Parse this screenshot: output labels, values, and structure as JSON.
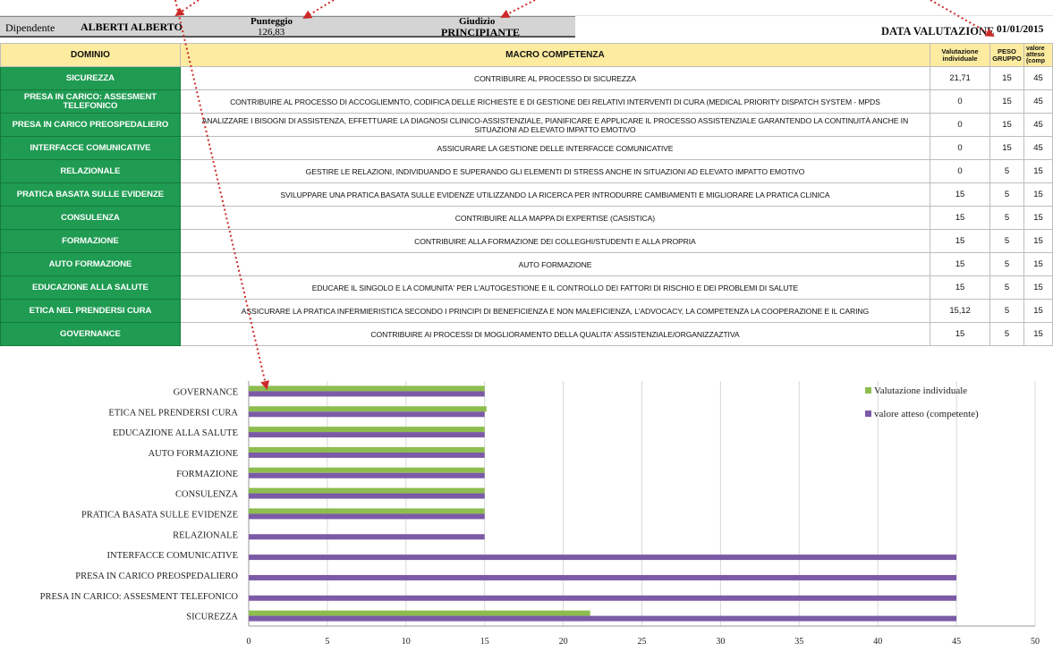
{
  "header": {
    "dipendente_label": "Dipendente",
    "dipendente_value": "ALBERTI ALBERTO",
    "punteggio_label": "Punteggio",
    "punteggio_value": "126,83",
    "giudizio_label": "Giudizio",
    "giudizio_value": "PRINCIPIANTE",
    "data_label": "DATA VALUTAZIONE",
    "data_value": "01/01/2015"
  },
  "table": {
    "headers": {
      "dominio": "DOMINIO",
      "macro": "MACRO COMPETENZA",
      "valutazione": [
        "Valutazione",
        "individuale"
      ],
      "peso": [
        "PESO",
        "GRUPPO"
      ],
      "valore": [
        "valore",
        "atteso",
        "(comp"
      ]
    },
    "rows": [
      {
        "dominio": "SICUREZZA",
        "macro": "CONTRIBUIRE AL PROCESSO DI SICUREZZA",
        "valutazione": "21,71",
        "peso": "15",
        "valore": "45"
      },
      {
        "dominio": "PRESA IN CARICO: ASSESMENT TELEFONICO",
        "macro": "CONTRIBUIRE AL PROCESSO DI ACCOGLIEMNTO, CODIFICA DELLE RICHIESTE E DI GESTIONE DEI RELATIVI INTERVENTI DI CURA (MEDICAL PRIORITY DISPATCH SYSTEM - MPDS",
        "valutazione": "0",
        "peso": "15",
        "valore": "45"
      },
      {
        "dominio": "PRESA IN CARICO  PREOSPEDALIERO",
        "macro": "ANALIZZARE I BISOGNI DI ASSISTENZA, EFFETTUARE LA DIAGNOSI CLINICO-ASSISTENZIALE, PIANIFICARE E APPLICARE IL PROCESSO ASSISTENZIALE  GARANTENDO LA CONTINUITÀ ANCHE IN SITUAZIONI AD ELEVATO IMPATTO EMOTIVO",
        "valutazione": "0",
        "peso": "15",
        "valore": "45"
      },
      {
        "dominio": "INTERFACCE COMUNICATIVE",
        "macro": "ASSICURARE LA GESTIONE DELLE INTERFACCE COMUNICATIVE",
        "valutazione": "0",
        "peso": "15",
        "valore": "45"
      },
      {
        "dominio": "RELAZIONALE",
        "macro": "GESTIRE LE RELAZIONI, INDIVIDUANDO E SUPERANDO GLI ELEMENTI DI STRESS ANCHE IN SITUAZIONI AD ELEVATO IMPATTO EMOTIVO",
        "valutazione": "0",
        "peso": "5",
        "valore": "15"
      },
      {
        "dominio": "PRATICA BASATA SULLE EVIDENZE",
        "macro": "SVILUPPARE UNA PRATICA BASATA SULLE EVIDENZE UTILIZZANDO LA RICERCA PER INTRODURRE CAMBIAMENTI E MIGLIORARE LA PRATICA CLINICA",
        "valutazione": "15",
        "peso": "5",
        "valore": "15"
      },
      {
        "dominio": "CONSULENZA",
        "macro": "CONTRIBUIRE ALLA MAPPA DI EXPERTISE  (CASISTICA)",
        "valutazione": "15",
        "peso": "5",
        "valore": "15"
      },
      {
        "dominio": "FORMAZIONE",
        "macro": "CONTRIBUIRE ALLA FORMAZIONE DEI COLLEGHI/STUDENTI E ALLA PROPRIA",
        "valutazione": "15",
        "peso": "5",
        "valore": "15"
      },
      {
        "dominio": "AUTO FORMAZIONE",
        "macro": "AUTO FORMAZIONE",
        "valutazione": "15",
        "peso": "5",
        "valore": "15"
      },
      {
        "dominio": "EDUCAZIONE ALLA SALUTE",
        "macro": "EDUCARE IL SINGOLO E LA COMUNITA' PER L'AUTOGESTIONE E IL CONTROLLO DEI FATTORI DI RISCHIO E DEI PROBLEMI DI SALUTE",
        "valutazione": "15",
        "peso": "5",
        "valore": "15"
      },
      {
        "dominio": "ETICA NEL PRENDERSI CURA",
        "macro": "ASSICURARE LA PRATICA INFERMIERISTICA SECONDO I PRINCIPI DI BENEFICIENZA E NON MALEFICIENZA, L'ADVOCACY,  LA COMPETENZA  LA COOPERAZIONE E IL CARING",
        "valutazione": "15,12",
        "peso": "5",
        "valore": "15"
      },
      {
        "dominio": "GOVERNANCE",
        "macro": "CONTRIBUIRE AI PROCESSI DI MOGLIORAMENTO DELLA QUALITA' ASSISTENZIALE/ORGANIZZAZTIVA",
        "valutazione": "15",
        "peso": "5",
        "valore": "15"
      }
    ]
  },
  "colors": {
    "dominio_bg": "#1f9b52",
    "header_bg": "#fdeba0",
    "valutazione_series": "#8dbd4f",
    "valore_series": "#7b5aa6",
    "arrow": "#cc2a2a"
  },
  "chart_data": {
    "type": "bar",
    "orientation": "horizontal",
    "categories": [
      "GOVERNANCE",
      "ETICA NEL PRENDERSI CURA",
      "EDUCAZIONE ALLA SALUTE",
      "AUTO FORMAZIONE",
      "FORMAZIONE",
      "CONSULENZA",
      "PRATICA BASATA SULLE EVIDENZE",
      "RELAZIONALE",
      "INTERFACCE COMUNICATIVE",
      "PRESA IN CARICO  PREOSPEDALIERO",
      "PRESA IN CARICO: ASSESMENT TELEFONICO",
      "SICUREZZA"
    ],
    "series": [
      {
        "name": "Valutazione individuale",
        "color": "#8dbd4f",
        "values": [
          15,
          15.12,
          15,
          15,
          15,
          15,
          15,
          0,
          0,
          0,
          0,
          21.71
        ]
      },
      {
        "name": "valore atteso (competente)",
        "color": "#7b5aa6",
        "values": [
          15,
          15,
          15,
          15,
          15,
          15,
          15,
          15,
          45,
          45,
          45,
          45
        ]
      }
    ],
    "xlim": [
      0,
      50
    ],
    "xticks": [
      "0",
      "5",
      "10",
      "15",
      "20",
      "25",
      "30",
      "35",
      "40",
      "45",
      "50"
    ],
    "grid": true,
    "legend_position": "top-right"
  }
}
